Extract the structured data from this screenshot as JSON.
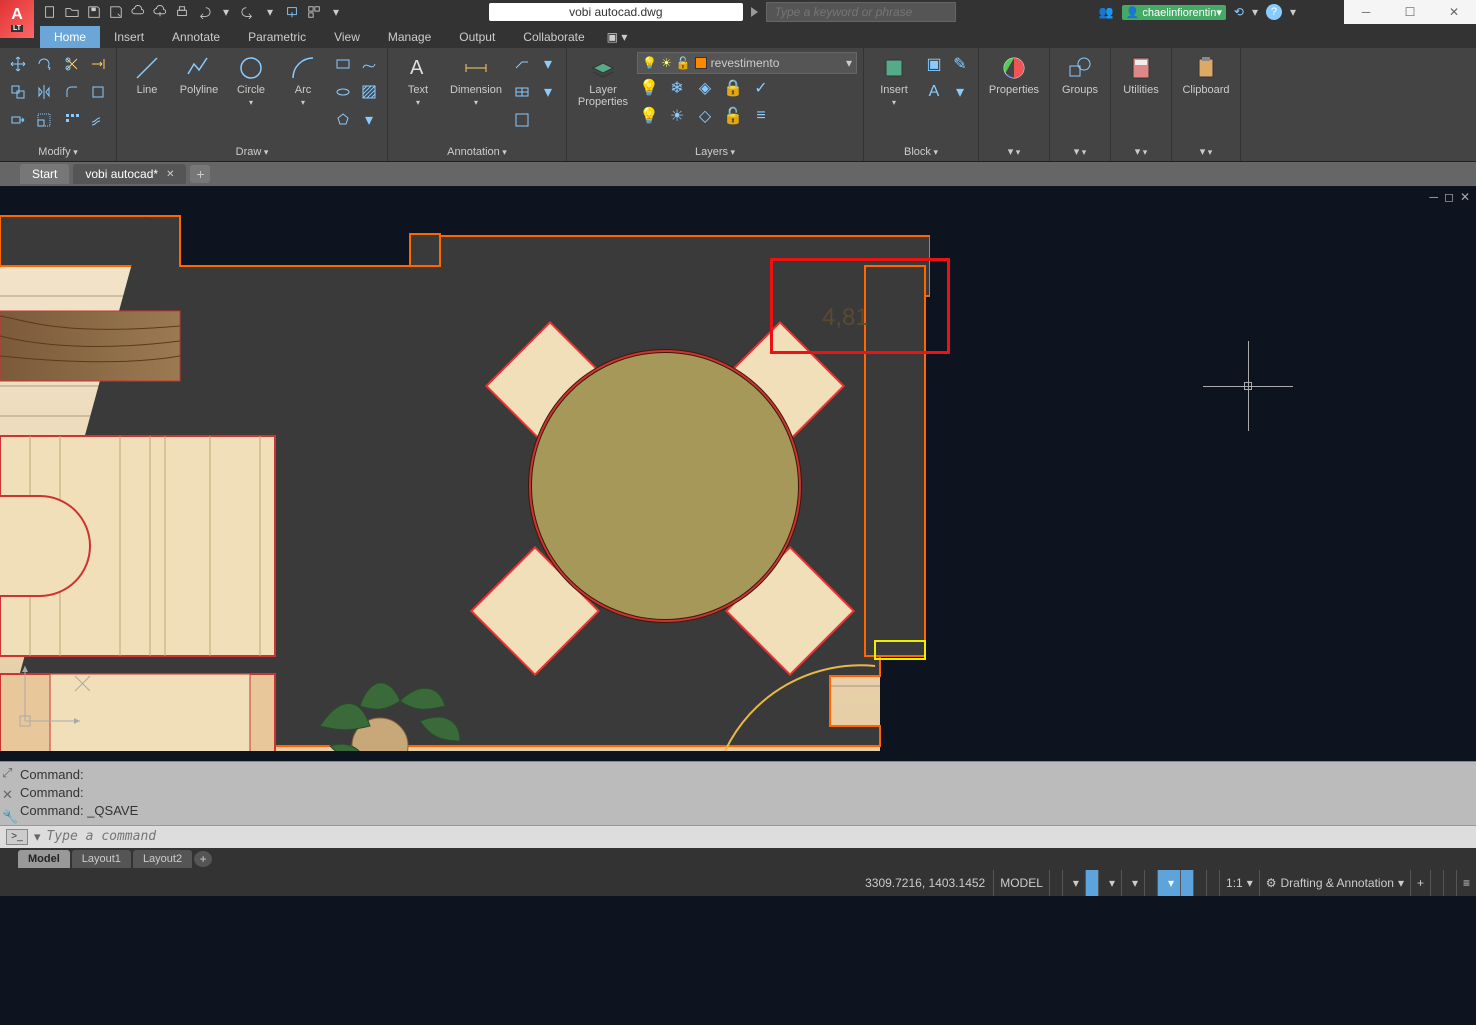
{
  "app": {
    "logo_letter": "A",
    "logo_sub": "LT"
  },
  "title": {
    "filename": "vobi autocad.dwg",
    "search_placeholder": "Type a keyword or phrase",
    "username": "chaelinfiorentin"
  },
  "ribbon": {
    "tabs": [
      "Home",
      "Insert",
      "Annotate",
      "Parametric",
      "View",
      "Manage",
      "Output",
      "Collaborate"
    ],
    "active_tab": "Home",
    "panels": {
      "modify": "Modify",
      "draw": "Draw",
      "annotation": "Annotation",
      "layers": "Layers",
      "block": "Block",
      "properties": "Properties",
      "groups": "Groups",
      "utilities": "Utilities",
      "clipboard": "Clipboard"
    },
    "draw_buttons": {
      "line": "Line",
      "polyline": "Polyline",
      "circle": "Circle",
      "arc": "Arc"
    },
    "annotation_buttons": {
      "text": "Text",
      "dimension": "Dimension"
    },
    "layer_button": "Layer\nProperties",
    "current_layer": "revestimento",
    "insert_button": "Insert",
    "properties_button": "Properties",
    "groups_button": "Groups",
    "utilities_button": "Utilities",
    "clipboard_button": "Clipboard"
  },
  "file_tabs": {
    "items": [
      {
        "label": "Start",
        "active": false,
        "dirty": false
      },
      {
        "label": "vobi autocad*",
        "active": true,
        "dirty": true
      }
    ]
  },
  "canvas": {
    "dimension_value": "4,81"
  },
  "command": {
    "history": [
      "Command:",
      "Command:",
      "Command: _QSAVE"
    ],
    "placeholder": "Type a command"
  },
  "layout_tabs": {
    "items": [
      "Model",
      "Layout1",
      "Layout2"
    ],
    "active": "Model"
  },
  "status": {
    "coords": "3309.7216, 1403.1452",
    "space": "MODEL",
    "scale": "1:1",
    "workspace": "Drafting & Annotation"
  }
}
